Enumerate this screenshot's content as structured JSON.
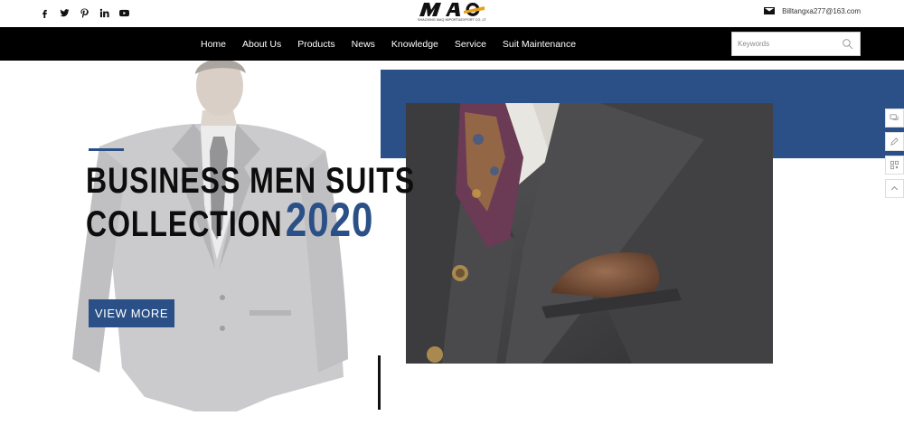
{
  "topbar": {
    "socials": [
      {
        "icon": "facebook-icon"
      },
      {
        "icon": "twitter-icon"
      },
      {
        "icon": "pinterest-icon"
      },
      {
        "icon": "linkedin-icon"
      },
      {
        "icon": "youtube-icon"
      }
    ],
    "logo": {
      "mark": "MAQ",
      "sub": "SHAOXING MAQ IMPORT&EXPORT CO.,LTD."
    },
    "email": {
      "icon": "envelope-icon",
      "text": "Billtangxa277@163.com"
    }
  },
  "nav": {
    "items": [
      "Home",
      "About Us",
      "Products",
      "News",
      "Knowledge",
      "Service",
      "Suit Maintenance"
    ],
    "search": {
      "placeholder": "Keywords",
      "value": "",
      "icon": "search-icon"
    }
  },
  "hero": {
    "title_line1": "BUSINESS MEN SUITS",
    "title_line2": "COLLECTION",
    "year": "2020",
    "button": "VIEW MORE",
    "accent_color": "#2a5087"
  },
  "float_bar": {
    "buttons": [
      "chat-icon",
      "edit-icon",
      "qrcode-icon",
      "back-to-top-icon"
    ]
  }
}
